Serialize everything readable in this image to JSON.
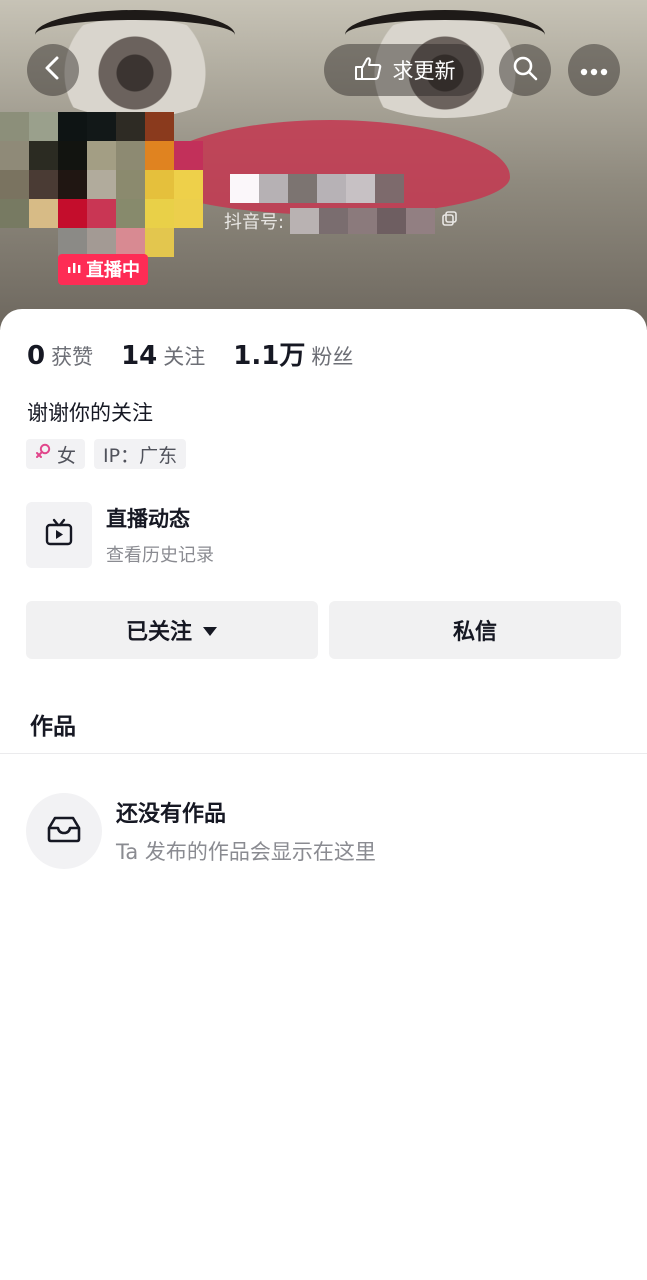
{
  "topbar": {
    "update_label": "求更新"
  },
  "profile": {
    "douyin_id_label": "抖音号:",
    "live_badge": "直播中"
  },
  "stats": [
    {
      "num": "0",
      "label": "获赞"
    },
    {
      "num": "14",
      "label": "关注"
    },
    {
      "num": "1.1万",
      "label": "粉丝"
    }
  ],
  "bio": "谢谢你的关注",
  "tags": {
    "gender": "女",
    "ip": "IP：广东"
  },
  "live_dynamic": {
    "title": "直播动态",
    "subtitle": "查看历史记录"
  },
  "buttons": {
    "followed": "已关注",
    "message": "私信"
  },
  "works": {
    "title": "作品",
    "empty_title": "还没有作品",
    "empty_subtitle": "Ta 发布的作品会显示在这里"
  },
  "colors": {
    "accent": "#fe2c55",
    "gender_icon": "#e1468b"
  },
  "icons": [
    "back-arrow-icon",
    "hand-point-icon",
    "search-icon",
    "more-icon",
    "live-bars-icon",
    "female-icon",
    "tv-icon",
    "caret-down-icon",
    "inbox-icon",
    "copy-icon"
  ]
}
